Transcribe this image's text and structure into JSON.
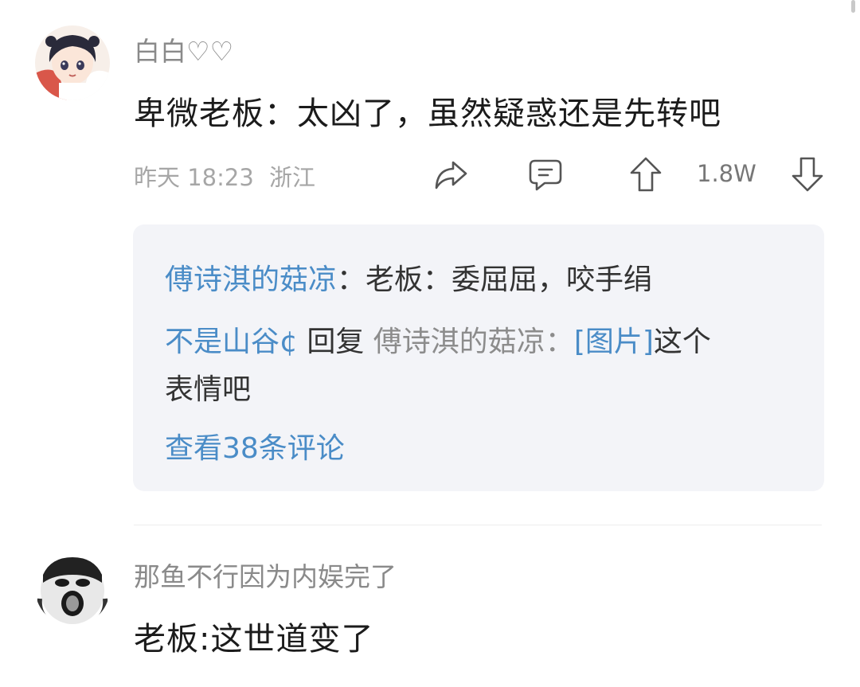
{
  "comments": [
    {
      "username": "白白♡♡",
      "text": "卑微老板：太凶了，虽然疑惑还是先转吧",
      "time": "昨天 18:23",
      "location": "浙江",
      "likes": "1.8W",
      "replies": {
        "line1_author": "傅诗淇的菇凉",
        "line1_sep": "：",
        "line1_text": "老板：委屈屈，咬手绢",
        "line2_author": "不是山谷¢",
        "line2_reply_word": " 回复 ",
        "line2_target": "傅诗淇的菇凉：",
        "line2_image": "[图片]",
        "line2_text": "这个",
        "line2_text_cont": "表情吧",
        "view_all": "查看38条评论"
      }
    },
    {
      "username": "那鱼不行因为内娱完了",
      "text": "老板:这世道变了"
    }
  ],
  "icons": {
    "share": "share-icon",
    "comment": "comment-icon",
    "upvote": "upvote-icon",
    "downvote": "downvote-icon"
  },
  "colors": {
    "link_blue": "#4a8cc7",
    "reply_bg": "#f3f4f8",
    "meta_gray": "#a6a6a6"
  }
}
